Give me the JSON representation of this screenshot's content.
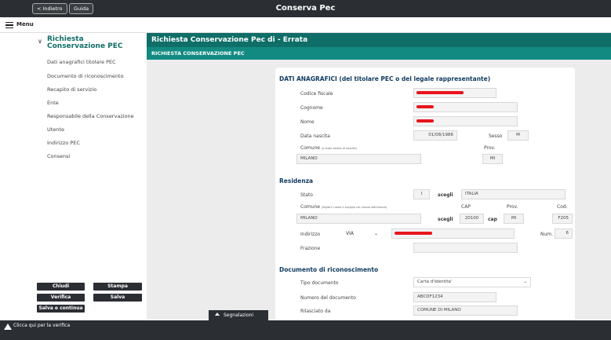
{
  "topbar": {
    "back_label": "< Indietro",
    "help_label": "Guida",
    "title": "Conserva Pec"
  },
  "menu": {
    "label": "Menu"
  },
  "sidebar": {
    "title": "Richiesta Conservazione PEC",
    "items": [
      {
        "label": "Dati anagrafici titolare PEC"
      },
      {
        "label": "Documento di riconoscimento"
      },
      {
        "label": "Recapito di servizio"
      },
      {
        "label": "Ente"
      },
      {
        "label": "Responsabile della Conservazione"
      },
      {
        "label": "Utente"
      },
      {
        "label": "Indirizzo PEC"
      },
      {
        "label": "Consensi"
      }
    ],
    "buttons": {
      "chiudi": "Chiudi",
      "stampa": "Stampa",
      "verifica": "Verifica",
      "salva": "Salva",
      "salva_continua": "Salva e continua"
    }
  },
  "main": {
    "header": "Richiesta Conservazione Pec di - Errata",
    "subheader": "RICHIESTA CONSERVAZIONE PEC"
  },
  "anagrafici": {
    "title": "DATI ANAGRAFICI (del titolare PEC o del legale rappresentante)",
    "codice_fiscale_label": "Codice fiscale",
    "cognome_label": "Cognome",
    "nome_label": "Nome",
    "data_nascita_label": "Data nascita",
    "data_nascita_value": "01/08/1986",
    "sesso_label": "Sesso",
    "sesso_value": "M",
    "comune_label": "Comune",
    "comune_hint": "(o stato estero di nascita)",
    "prov_label": "Prov.",
    "comune_value": "MILANO",
    "prov_value": "MI"
  },
  "residenza": {
    "title": "Residenza",
    "stato_label": "Stato",
    "stato_code": "I",
    "scegli_label": "scegli",
    "stato_value": "ITALIA",
    "comune_label": "Comune",
    "comune_hint": "(digita il nome e scegli/o col mouse dall'elenco)",
    "cap_label": "CAP",
    "prov_label": "Prov.",
    "cod_label": "Cod.",
    "comune_value": "MILANO",
    "cap_value": "20100",
    "cap_button": "cap",
    "prov_value": "MI",
    "cod_value": "F205",
    "indirizzo_label": "Indirizzo",
    "via_value": "VIA",
    "num_label": "Num.",
    "num_value": "6",
    "frazione_label": "Frazione"
  },
  "documento": {
    "title": "Documento di riconoscimento",
    "tipo_label": "Tipo documento",
    "tipo_value": "Carta d'identita'",
    "numero_label": "Numero del documento",
    "numero_value": "ABCDF1234",
    "rilasciato_label": "Rilasciato da",
    "rilasciato_value": "COMUNE DI MILANO"
  },
  "footer": {
    "segnalazioni": "Segnalazioni",
    "verifica_text": "Clicca qui per la verifica"
  }
}
